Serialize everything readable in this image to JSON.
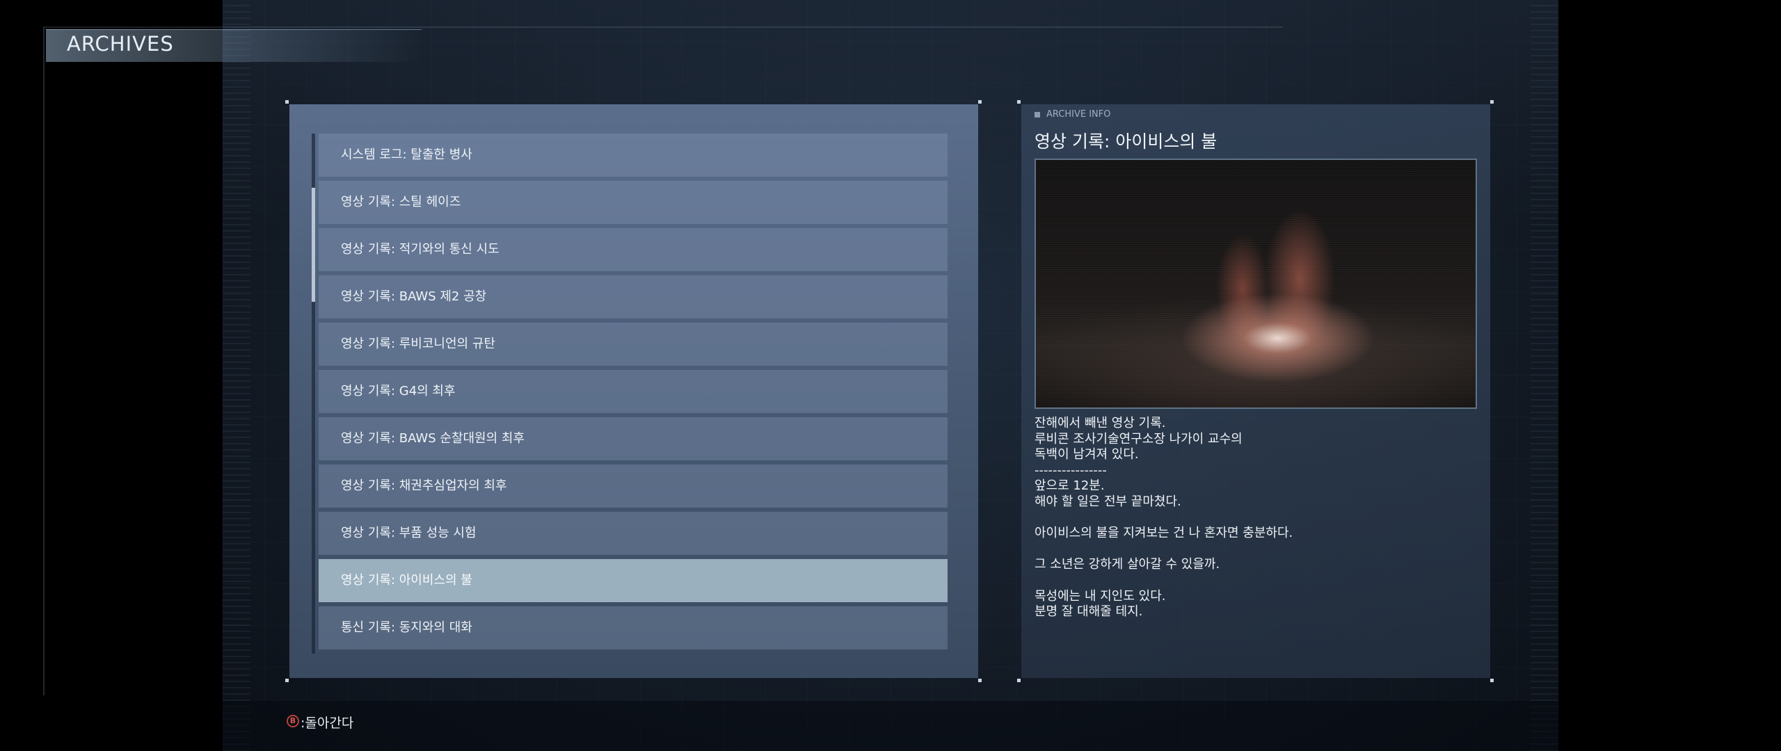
{
  "header": {
    "title": "ARCHIVES"
  },
  "archive_list": {
    "selected_index": 9,
    "items": [
      {
        "label": "시스템 로그: 탈출한 병사"
      },
      {
        "label": "영상 기록: 스틸 헤이즈"
      },
      {
        "label": "영상 기록: 적기와의 통신 시도"
      },
      {
        "label": "영상 기록: BAWS 제2 공창"
      },
      {
        "label": "영상 기록: 루비코니언의 규탄"
      },
      {
        "label": "영상 기록: G4의 최후"
      },
      {
        "label": "영상 기록: BAWS 순찰대원의 최후"
      },
      {
        "label": "영상 기록: 채권추심업자의 최후"
      },
      {
        "label": "영상 기록: 부품 성능 시험"
      },
      {
        "label": "영상 기록: 아이비스의 불"
      },
      {
        "label": "통신 기록: 동지와의 대화"
      }
    ]
  },
  "info": {
    "tag": "ARCHIVE INFO",
    "title": "영상 기록: 아이비스의 불",
    "lines": [
      "잔해에서 빼낸 영상 기록.",
      "루비콘 조사기술연구소장 나가이 교수의",
      "독백이 남겨져 있다.",
      "----------------",
      "앞으로 12분.",
      "해야 할 일은 전부 끝마쳤다.",
      "",
      "아이비스의 불을 지켜보는 건 나 혼자면 충분하다.",
      "",
      "그 소년은 강하게 살아갈 수 있을까.",
      "",
      "목성에는 내 지인도 있다.",
      "분명 잘 대해줄 테지."
    ]
  },
  "footer": {
    "back_button_glyph": "B",
    "back_label": ":돌아간다"
  }
}
